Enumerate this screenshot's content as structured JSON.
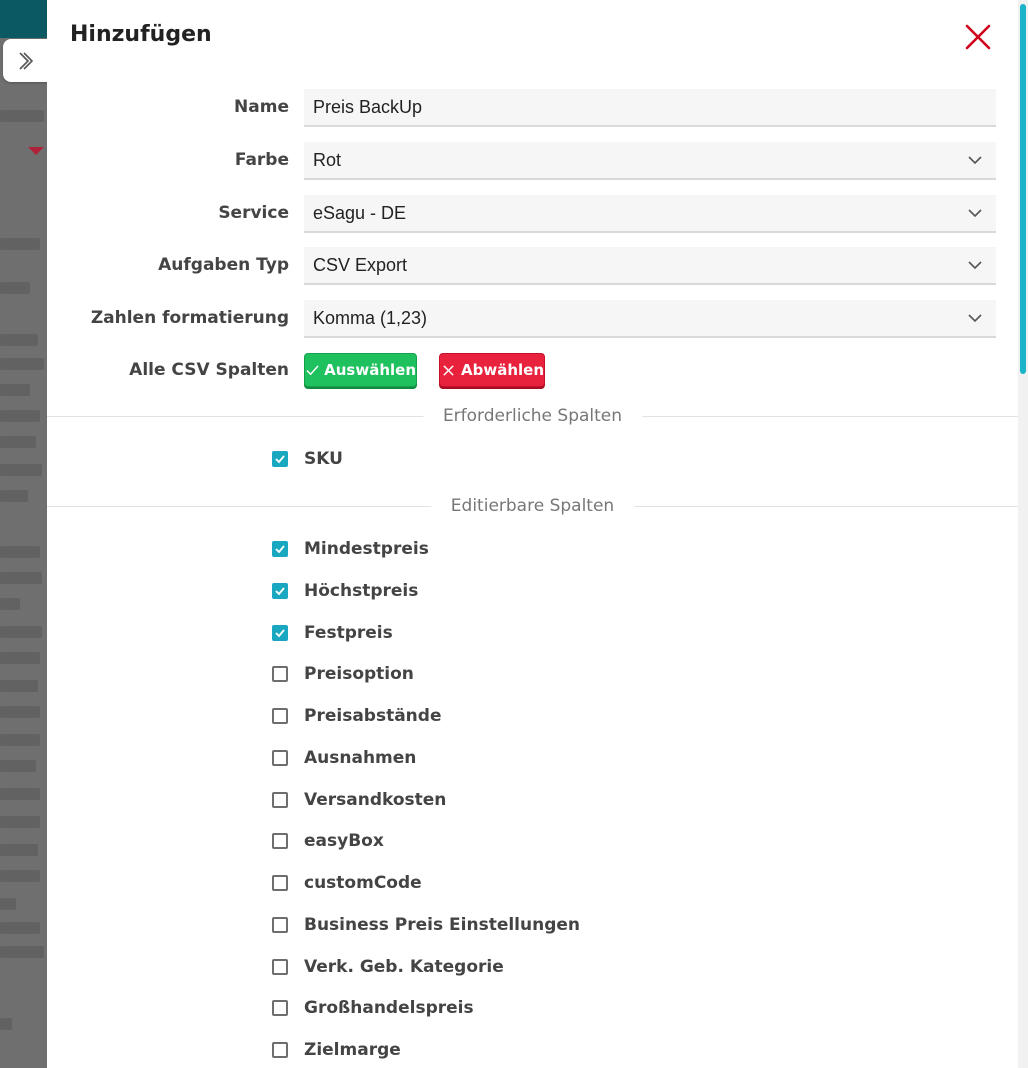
{
  "dialog": {
    "title": "Hinzufügen"
  },
  "form": {
    "name": {
      "label": "Name",
      "value": "Preis BackUp"
    },
    "color": {
      "label": "Farbe",
      "value": "Rot"
    },
    "service": {
      "label": "Service",
      "value": "eSagu - DE"
    },
    "task_type": {
      "label": "Aufgaben Typ",
      "value": "CSV Export"
    },
    "number_format": {
      "label": "Zahlen formatierung",
      "value": "Komma (1,23)"
    },
    "all_columns": {
      "label": "Alle CSV Spalten",
      "select_label": "Auswählen",
      "deselect_label": "Abwählen"
    }
  },
  "required_section": {
    "title": "Erforderliche Spalten",
    "items": [
      {
        "label": "SKU",
        "checked": true
      }
    ]
  },
  "editable_section": {
    "title": "Editierbare Spalten",
    "items": [
      {
        "label": "Mindestpreis",
        "checked": true
      },
      {
        "label": "Höchstpreis",
        "checked": true
      },
      {
        "label": "Festpreis",
        "checked": true
      },
      {
        "label": "Preisoption",
        "checked": false
      },
      {
        "label": "Preisabstände",
        "checked": false
      },
      {
        "label": "Ausnahmen",
        "checked": false
      },
      {
        "label": "Versandkosten",
        "checked": false
      },
      {
        "label": "easyBox",
        "checked": false
      },
      {
        "label": "customCode",
        "checked": false
      },
      {
        "label": "Business Preis Einstellungen",
        "checked": false
      },
      {
        "label": "Verk. Geb. Kategorie",
        "checked": false
      },
      {
        "label": "Großhandelspreis",
        "checked": false
      },
      {
        "label": "Zielmarge",
        "checked": false
      }
    ]
  },
  "colors": {
    "accent": "#1aa8c1",
    "select_green": "#1fc05e",
    "deselect_red": "#e8213c",
    "close_red": "#d0021b",
    "header_teal": "#0b5a63"
  },
  "icons": {
    "expand": "chevron-right-icon",
    "close": "close-icon",
    "dropdown": "chevron-down-icon",
    "check": "check-icon"
  }
}
